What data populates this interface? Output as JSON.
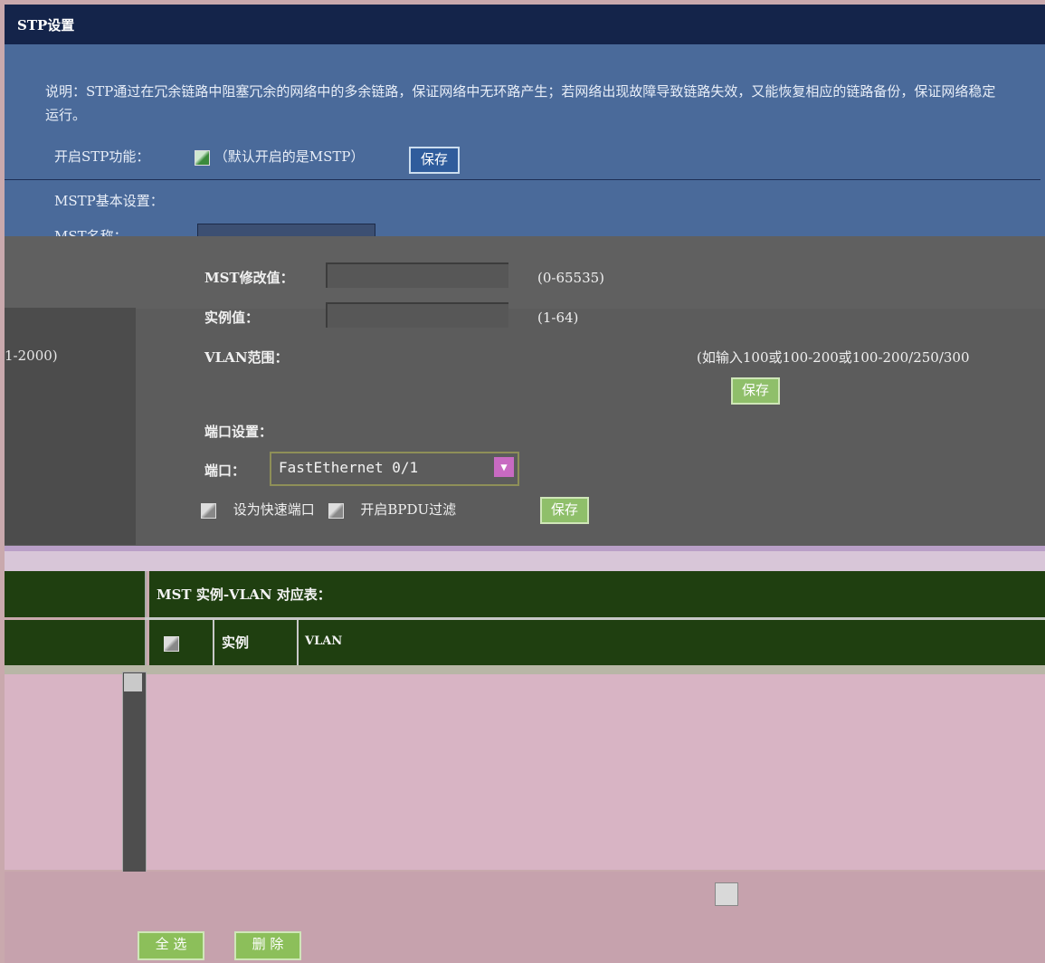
{
  "title": "STP设置",
  "description": "说明：STP通过在冗余链路中阻塞冗余的网络中的多余链路，保证网络中无环路产生；若网络出现故障导致链路失效，又能恢复相应的链路备份，保证网络稳定运行。",
  "stp_enable": {
    "label": "开启STP功能：",
    "note": "（默认开启的是MSTP）",
    "save_label": "保存"
  },
  "mstp_basic": {
    "section_label": "MSTP基本设置：",
    "name_label": "MST名称：",
    "name_value": "",
    "revision_label": "MST修改值：",
    "revision_value": "",
    "revision_range": "(0-65535)",
    "instance_label": "实例值：",
    "instance_value": "",
    "instance_range": "(1-64)",
    "vlan_label": "VLAN范围：",
    "vlan_range_left": "1-2000)",
    "vlan_hint": "(如输入100或100-200或100-200/250/300",
    "save_label": "保存"
  },
  "port_settings": {
    "section_label": "端口设置：",
    "port_label": "端口：",
    "port_value": "FastEthernet 0/1",
    "fast_port_label": "设为快速端口",
    "bpdu_label": "开启BPDU过滤",
    "save_label": "保存"
  },
  "table": {
    "title": "MST 实例-VLAN 对应表：",
    "col_instance": "实例",
    "col_vlan": "VLAN"
  },
  "footer": {
    "select_all_label": "全 选",
    "delete_label": "删 除"
  }
}
